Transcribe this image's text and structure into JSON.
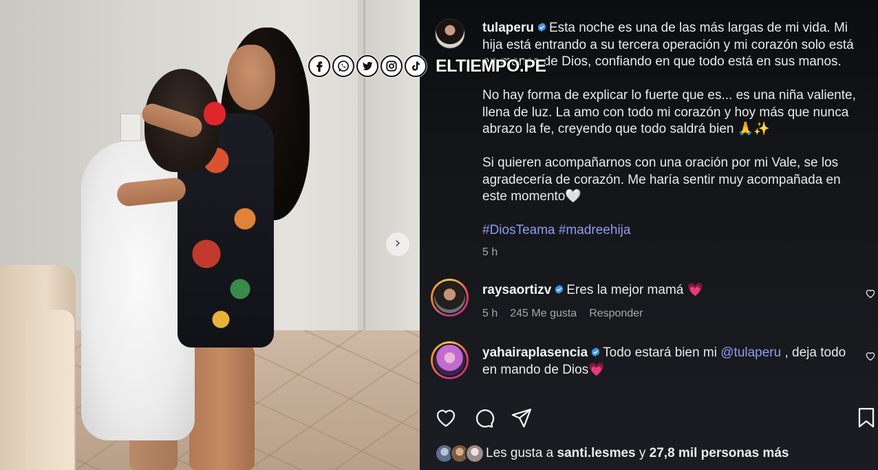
{
  "watermark": {
    "brand": "ELTIEMPO.PE",
    "social_icons": [
      "facebook-icon",
      "whatsapp-icon",
      "twitter-icon",
      "instagram-icon",
      "tiktok-icon"
    ]
  },
  "carousel": {
    "next_glyph": "›"
  },
  "post": {
    "username": "tulaperu",
    "verified": true,
    "caption_p1": "Esta noche es una de las más largas de mi vida. Mi hija está entrando a su tercera operación y mi corazón solo está en manos de Dios, confiando en que todo está en sus manos.",
    "caption_p2": "No hay forma de explicar lo fuerte que es... es una niña valiente, llena de luz. La amo con todo mi corazón y hoy más que nunca abrazo la fe, creyendo que todo saldrá bien 🙏✨",
    "caption_p3": "Si quieren acompañarnos con una oración por mi Vale, se los agradecería de corazón. Me haría sentir muy acompañada en este momento🤍",
    "hashtags": "#DiosTeama #madreehija",
    "time": "5 h"
  },
  "comments": [
    {
      "username": "raysaortizv",
      "text": "Eres la mejor mamá 💗",
      "time": "5 h",
      "likes": "245 Me gusta",
      "reply": "Responder"
    },
    {
      "username": "yahairaplasencia",
      "text_before": "Todo estará bien mi ",
      "mention": "@tulaperu",
      "text_after": " , deja todo en mando de Dios💗"
    }
  ],
  "likes_summary": {
    "prefix": "Les gusta a ",
    "user": "santi.lesmes",
    "middle": " y ",
    "count": "27,8 mil personas más"
  },
  "colors": {
    "panel_bg": "#1a1c21",
    "hashtag": "#8e9cf0",
    "verified": "#3897f0",
    "heart": "#ff3b6b"
  }
}
